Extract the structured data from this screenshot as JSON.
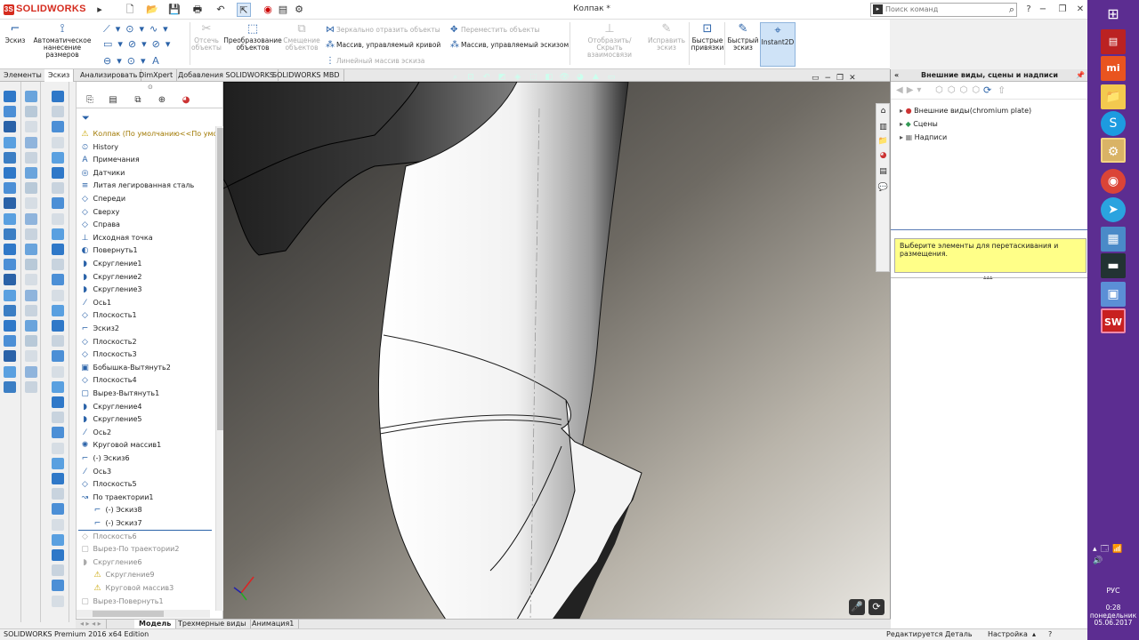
{
  "app": {
    "name": "SOLIDWORKS",
    "document_title": "Колпак *"
  },
  "search": {
    "placeholder": "Поиск команд"
  },
  "ribbon": {
    "sketch": "Эскиз",
    "smart_dim": "Автоматическое нанесение размеров",
    "trim": "Отсечь объекты",
    "convert": "Преобразование объектов",
    "offset": "Смещение объектов",
    "mirror": "Зеркально отразить объекты",
    "curve_pattern": "Массив, управляемый кривой",
    "linear_pattern": "Линейный массив эскиза",
    "move": "Переместить объекты",
    "sketch_pattern": "Массив, управляемый эскизом",
    "show_hide": "Отобразить/Скрыть взаимосвязи",
    "repair": "Исправить эскиз",
    "quick_snaps": "Быстрые привязки",
    "rapid_sketch": "Быстрый эскиз",
    "instant2d": "Instant2D"
  },
  "tabs": [
    "Элементы",
    "Эскиз",
    "Анализировать",
    "DimXpert",
    "Добавления SOLIDWORKS",
    "SOLIDWORKS MBD"
  ],
  "tree": [
    {
      "label": "Колпак  (По умолчанию<<По умолча",
      "icon": "part-icon",
      "grey": false,
      "indent": 0
    },
    {
      "label": "History",
      "icon": "history-icon",
      "grey": false,
      "indent": 0
    },
    {
      "label": "Примечания",
      "icon": "annotations-icon",
      "grey": false,
      "indent": 0
    },
    {
      "label": "Датчики",
      "icon": "sensors-icon",
      "grey": false,
      "indent": 0
    },
    {
      "label": "Литая легированная сталь",
      "icon": "material-icon",
      "grey": false,
      "indent": 0
    },
    {
      "label": "Спереди",
      "icon": "plane-icon",
      "grey": false,
      "indent": 0
    },
    {
      "label": "Сверху",
      "icon": "plane-icon",
      "grey": false,
      "indent": 0
    },
    {
      "label": "Справа",
      "icon": "plane-icon",
      "grey": false,
      "indent": 0
    },
    {
      "label": "Исходная точка",
      "icon": "origin-icon",
      "grey": false,
      "indent": 0
    },
    {
      "label": "Повернуть1",
      "icon": "revolve-icon",
      "grey": false,
      "indent": 0
    },
    {
      "label": "Скругление1",
      "icon": "fillet-icon",
      "grey": false,
      "indent": 0
    },
    {
      "label": "Скругление2",
      "icon": "fillet-icon",
      "grey": false,
      "indent": 0
    },
    {
      "label": "Скругление3",
      "icon": "fillet-icon",
      "grey": false,
      "indent": 0
    },
    {
      "label": "Ось1",
      "icon": "axis-icon",
      "grey": false,
      "indent": 0
    },
    {
      "label": "Плоскость1",
      "icon": "plane-icon",
      "grey": false,
      "indent": 0
    },
    {
      "label": "Эскиз2",
      "icon": "sketch-icon",
      "grey": false,
      "indent": 0
    },
    {
      "label": "Плоскость2",
      "icon": "plane-icon",
      "grey": false,
      "indent": 0
    },
    {
      "label": "Плоскость3",
      "icon": "plane-icon",
      "grey": false,
      "indent": 0
    },
    {
      "label": "Бобышка-Вытянуть2",
      "icon": "extrude-icon",
      "grey": false,
      "indent": 0
    },
    {
      "label": "Плоскость4",
      "icon": "plane-icon",
      "grey": false,
      "indent": 0
    },
    {
      "label": "Вырез-Вытянуть1",
      "icon": "cut-icon",
      "grey": false,
      "indent": 0
    },
    {
      "label": "Скругление4",
      "icon": "fillet-icon",
      "grey": false,
      "indent": 0
    },
    {
      "label": "Скругление5",
      "icon": "fillet-icon",
      "grey": false,
      "indent": 0
    },
    {
      "label": "Ось2",
      "icon": "axis-icon",
      "grey": false,
      "indent": 0
    },
    {
      "label": "Круговой массив1",
      "icon": "pattern-icon",
      "grey": false,
      "indent": 0
    },
    {
      "label": "(-) Эскиз6",
      "icon": "sketch-icon",
      "grey": false,
      "indent": 0
    },
    {
      "label": "Ось3",
      "icon": "axis-icon",
      "grey": false,
      "indent": 0
    },
    {
      "label": "Плоскость5",
      "icon": "plane-icon",
      "grey": false,
      "indent": 0
    },
    {
      "label": "По траектории1",
      "icon": "sweep-icon",
      "grey": false,
      "indent": 0
    },
    {
      "label": "(-) Эскиз8",
      "icon": "sketch-icon",
      "grey": false,
      "indent": 1
    },
    {
      "label": "(-) Эскиз7",
      "icon": "sketch-icon",
      "grey": false,
      "indent": 1
    },
    {
      "label": "Плоскость6",
      "icon": "plane-icon",
      "grey": true,
      "indent": 0
    },
    {
      "label": "Вырез-По траектории2",
      "icon": "cut-icon",
      "grey": true,
      "indent": 0
    },
    {
      "label": "Скругление6",
      "icon": "fillet-icon",
      "grey": true,
      "indent": 0
    },
    {
      "label": "Скругление9",
      "icon": "warning-icon",
      "grey": true,
      "indent": 1
    },
    {
      "label": "Круговой массив3",
      "icon": "warning-icon",
      "grey": true,
      "indent": 1
    },
    {
      "label": "Вырез-Повернуть1",
      "icon": "cut-icon",
      "grey": true,
      "indent": 0
    }
  ],
  "bottom_tabs": [
    "Модель",
    "Трехмерные виды",
    "Анимация1"
  ],
  "status": {
    "edition": "SOLIDWORKS Premium 2016 x64 Edition",
    "editing": "Редактируется Деталь",
    "custom": "Настройка"
  },
  "taskpane": {
    "title": "Внешние виды, сцены и надписи",
    "items": [
      "Внешние виды(chromium plate)",
      "Сцены",
      "Надписи"
    ],
    "message": "Выберите элементы для перетаскивания и размещения."
  },
  "clock": {
    "time": "0:28",
    "day": "понедельник",
    "date": "05.06.2017",
    "lang": "РУС"
  }
}
